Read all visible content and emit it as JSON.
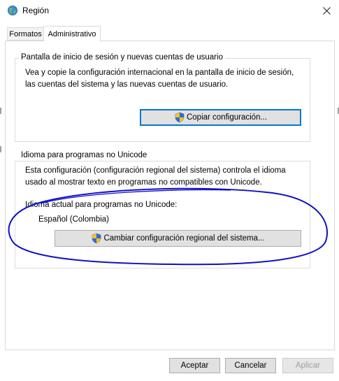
{
  "window": {
    "title": "Región",
    "app_icon": "globe-icon",
    "close_icon": "close-icon"
  },
  "tabs": [
    {
      "label": "Formatos",
      "active": false
    },
    {
      "label": "Administrativo",
      "active": true
    }
  ],
  "welcome_group": {
    "legend": "Pantalla de inicio de sesión y nuevas cuentas de usuario",
    "description": "Vea y copie la configuración internacional en la pantalla de inicio de sesión, las cuentas del sistema y las nuevas cuentas de usuario.",
    "button_label": "Copiar configuración...",
    "button_icon": "uac-shield-icon"
  },
  "unicode_group": {
    "legend": "Idioma para programas no Unicode",
    "description": "Esta configuración (configuración regional del sistema) controla el idioma usado al mostrar texto en programas no compatibles con Unicode.",
    "current_label": "Idioma actual para programas no Unicode:",
    "current_value": "Español (Colombia)",
    "button_label": "Cambiar configuración regional del sistema...",
    "button_icon": "uac-shield-icon",
    "annotation_color": "#1010c8"
  },
  "footer": {
    "ok": "Aceptar",
    "cancel": "Cancelar",
    "apply": "Aplicar"
  },
  "colors": {
    "accent": "#0078d7",
    "button_bg": "#e1e1e1",
    "group_border": "#dcdcdc"
  }
}
